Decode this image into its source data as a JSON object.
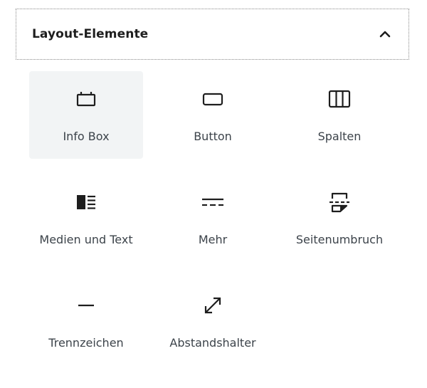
{
  "panel": {
    "title": "Layout-Elemente",
    "expanded": true,
    "toggle_icon": "chevron-up-icon"
  },
  "blocks": [
    {
      "label": "Info Box",
      "icon": "info-box-icon",
      "selected": true
    },
    {
      "label": "Button",
      "icon": "button-icon",
      "selected": false
    },
    {
      "label": "Spalten",
      "icon": "columns-icon",
      "selected": false
    },
    {
      "label": "Medien und Text",
      "icon": "media-text-icon",
      "selected": false
    },
    {
      "label": "Mehr",
      "icon": "more-icon",
      "selected": false
    },
    {
      "label": "Seitenumbruch",
      "icon": "page-break-icon",
      "selected": false
    },
    {
      "label": "Trennzeichen",
      "icon": "separator-icon",
      "selected": false
    },
    {
      "label": "Abstandshalter",
      "icon": "spacer-icon",
      "selected": false
    }
  ],
  "colors": {
    "selected_background": "#f2f4f5",
    "icon": "#1e1e1e",
    "label": "#3c434a"
  }
}
